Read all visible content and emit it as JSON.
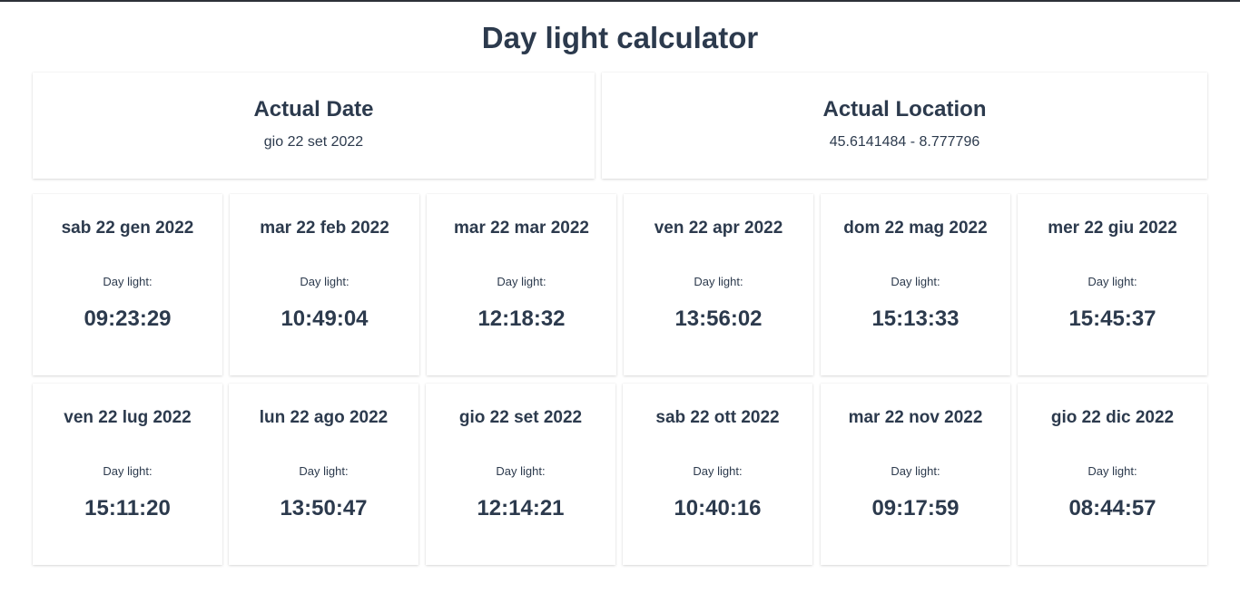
{
  "page": {
    "title": "Day light calculator"
  },
  "actual_date": {
    "title": "Actual Date",
    "value": "gio 22 set 2022"
  },
  "actual_location": {
    "title": "Actual Location",
    "value": "45.6141484 - 8.777796"
  },
  "months": [
    {
      "date": "sab 22 gen 2022",
      "label": "Day light:",
      "daylight": "09:23:29"
    },
    {
      "date": "mar 22 feb 2022",
      "label": "Day light:",
      "daylight": "10:49:04"
    },
    {
      "date": "mar 22 mar 2022",
      "label": "Day light:",
      "daylight": "12:18:32"
    },
    {
      "date": "ven 22 apr 2022",
      "label": "Day light:",
      "daylight": "13:56:02"
    },
    {
      "date": "dom 22 mag 2022",
      "label": "Day light:",
      "daylight": "15:13:33"
    },
    {
      "date": "mer 22 giu 2022",
      "label": "Day light:",
      "daylight": "15:45:37"
    },
    {
      "date": "ven 22 lug 2022",
      "label": "Day light:",
      "daylight": "15:11:20"
    },
    {
      "date": "lun 22 ago 2022",
      "label": "Day light:",
      "daylight": "13:50:47"
    },
    {
      "date": "gio 22 set 2022",
      "label": "Day light:",
      "daylight": "12:14:21"
    },
    {
      "date": "sab 22 ott 2022",
      "label": "Day light:",
      "daylight": "10:40:16"
    },
    {
      "date": "mar 22 nov 2022",
      "label": "Day light:",
      "daylight": "09:17:59"
    },
    {
      "date": "gio 22 dic 2022",
      "label": "Day light:",
      "daylight": "08:44:57"
    }
  ]
}
